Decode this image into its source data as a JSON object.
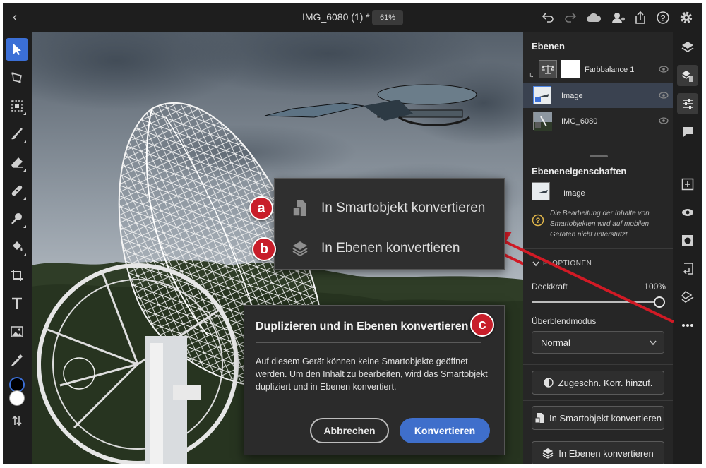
{
  "topbar": {
    "back_icon": "chevron-left-icon",
    "doc_title": "IMG_6080 (1) *",
    "zoom": "61%",
    "icons": [
      "undo-icon",
      "redo-icon",
      "cloud-icon",
      "share-user-icon",
      "export-icon",
      "help-icon",
      "gear-icon"
    ]
  },
  "tools": [
    "select-icon",
    "transform-icon",
    "selection-icon",
    "brush-icon",
    "eraser-icon",
    "heal-icon",
    "clone-icon",
    "fill-icon",
    "crop-icon",
    "text-icon",
    "place-image-icon",
    "eyedropper-icon"
  ],
  "colors": {
    "accent": "#3b6fd6",
    "primary_btn": "#3f6fcb",
    "marker": "#c81e2a",
    "arrow": "#d11a25",
    "fg_swatch": "#000000",
    "bg_swatch": "#ffffff"
  },
  "layers": {
    "title": "Ebenen",
    "items": [
      {
        "name": "Farbbalance 1"
      },
      {
        "name": "Image"
      },
      {
        "name": "IMG_6080"
      }
    ]
  },
  "properties": {
    "title": "Ebeneneigenschaften",
    "layer_name": "Image",
    "warning": "Die Bearbeitung der Inhalte von Smartobjekten wird auf mobilen Geräten nicht unterstützt",
    "section": "FÜLLOPTIONEN",
    "section_visible": "F  OPTIONEN",
    "opacity_label": "Deckkraft",
    "opacity_value": "100%",
    "opacity": 1.0,
    "blend_label": "Überblendmodus",
    "blend_value": "Normal",
    "btn_clip": "Zugeschn. Korr. hinzuf.",
    "btn_smart": "In Smartobjekt konvertieren",
    "btn_layers": "In Ebenen konvertieren"
  },
  "rail_icons": [
    "layers-icon",
    "layers-properties-icon",
    "adjustments-icon",
    "comment-icon",
    "add-layer-icon",
    "visibility-icon",
    "mask-icon",
    "import-icon",
    "clip-icon",
    "more-icon"
  ],
  "context_menu": {
    "items": [
      {
        "marker": "a",
        "label": "In Smartobjekt konvertieren"
      },
      {
        "marker": "b",
        "label": "In Ebenen konvertieren"
      }
    ]
  },
  "dialog": {
    "marker": "c",
    "title": "Duplizieren und in Ebenen konvertieren",
    "body": "Auf diesem Gerät können keine Smartobjekte geöffnet werden. Um den Inhalt zu bearbeiten, wird das Smartobjekt dupliziert und in Ebenen konvertiert.",
    "cancel": "Abbrechen",
    "confirm": "Konvertieren"
  }
}
